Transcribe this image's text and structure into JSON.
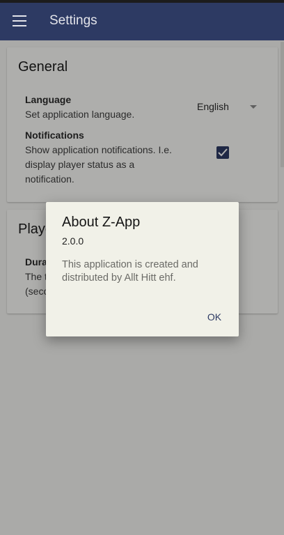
{
  "app_bar": {
    "title": "Settings"
  },
  "general": {
    "header": "General",
    "language": {
      "title": "Language",
      "description": "Set application language.",
      "value": "English"
    },
    "notifications": {
      "title": "Notifications",
      "description_line1": "Show application notifications. I.e.",
      "description_line2": "display player status as a",
      "description_line3": "notification.",
      "checked": true
    }
  },
  "player": {
    "header": "Player",
    "duration": {
      "title": "Duration",
      "description_line1": "The time",
      "description_line2": "(seconds)"
    }
  },
  "dialog": {
    "title": "About Z-App",
    "version": "2.0.0",
    "message": "This application is created and distributed by Allt Hitt ehf.",
    "ok_label": "OK"
  },
  "colors": {
    "primary": "#2d3a63",
    "background": "#f4f4f1",
    "dialog_bg": "#f1f1e8"
  }
}
